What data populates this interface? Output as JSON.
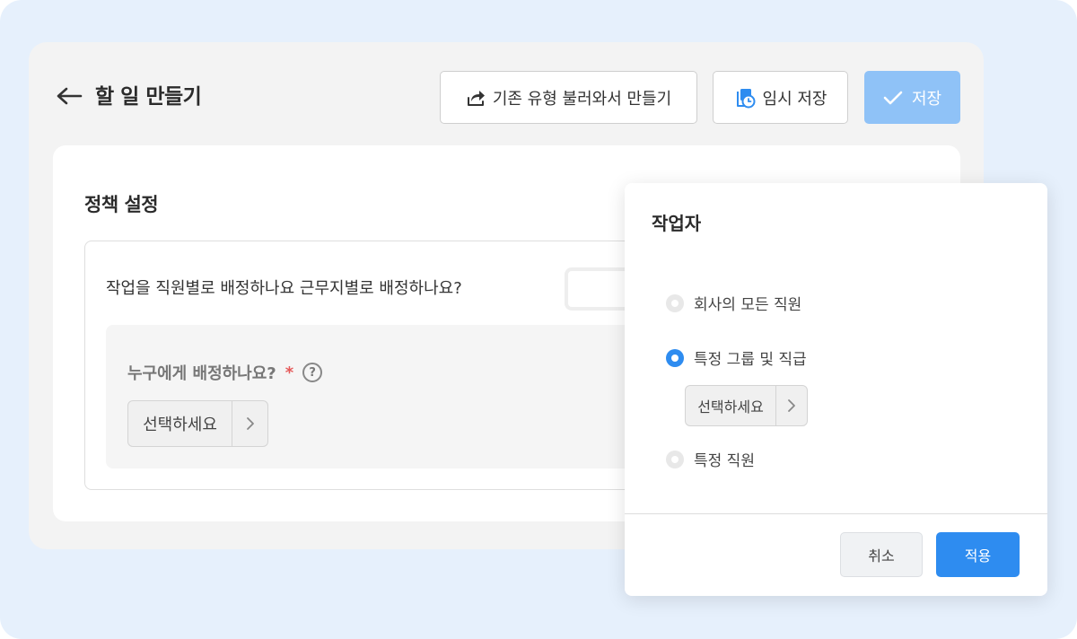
{
  "header": {
    "title": "할 일 만들기",
    "load_button_label": "기존 유형 불러와서 만들기",
    "temp_save_label": "임시 저장",
    "save_label": "저장"
  },
  "policy": {
    "section_title": "정책 설정",
    "assign_question": "작업을 직원별로 배정하나요 근무지별로 배정하나요?",
    "who_label": "누구에게 배정하나요?",
    "required_mark": "*",
    "select_placeholder": "선택하세요"
  },
  "modal": {
    "title": "작업자",
    "options": [
      {
        "label": "회사의 모든 직원",
        "selected": false
      },
      {
        "label": "특정 그룹 및 직급",
        "selected": true
      },
      {
        "label": "특정 직원",
        "selected": false
      }
    ],
    "select_placeholder": "선택하세요",
    "cancel_label": "취소",
    "apply_label": "적용"
  },
  "colors": {
    "accent": "#2e8cf0",
    "save_disabled": "#8fc2f7",
    "background": "#e6f0fc"
  }
}
